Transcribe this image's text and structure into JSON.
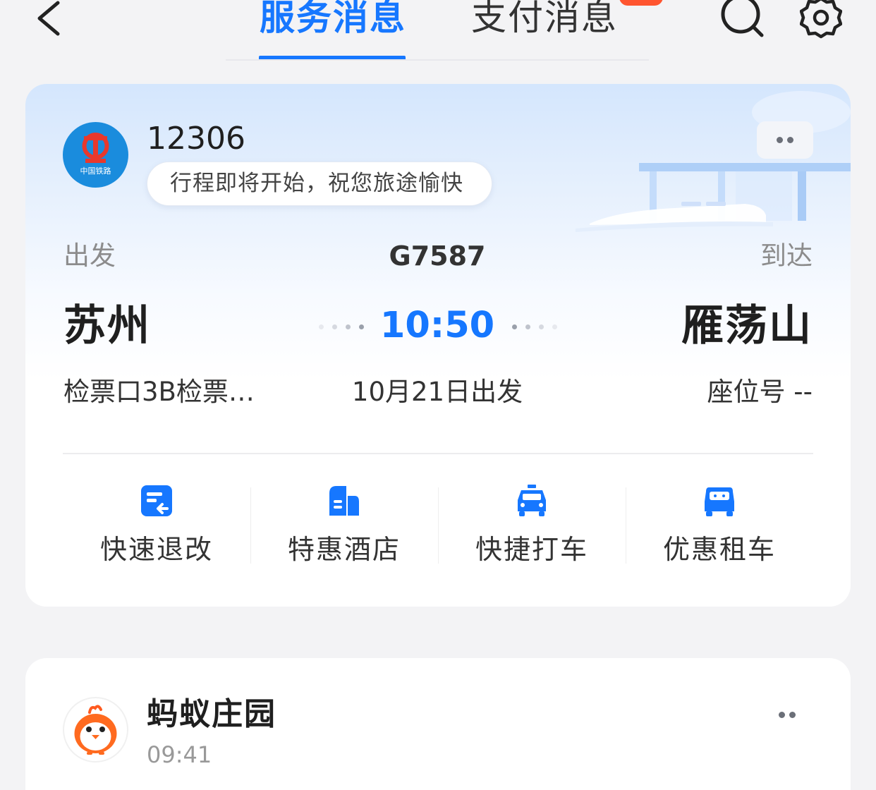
{
  "header": {
    "tabs": [
      {
        "label": "服务消息",
        "active": true
      },
      {
        "label": "支付消息",
        "active": false
      }
    ],
    "icons": [
      "back-icon",
      "search-icon",
      "settings-icon"
    ],
    "accent_color": "#1677ff"
  },
  "trip_card": {
    "sender": "12306",
    "logo_caption": "中国铁路",
    "notice": "行程即将开始，祝您旅途愉快",
    "depart_label": "出发",
    "arrive_label": "到达",
    "train_no": "G7587",
    "from_city": "苏州",
    "to_city": "雁荡山",
    "dep_time": "10:50",
    "gate": "检票口3B检票…",
    "dep_date": "10月21日出发",
    "seat": "座位号 --",
    "actions": [
      {
        "label": "快速退改",
        "icon": "refund-change-icon"
      },
      {
        "label": "特惠酒店",
        "icon": "hotel-icon"
      },
      {
        "label": "快捷打车",
        "icon": "taxi-icon"
      },
      {
        "label": "优惠租车",
        "icon": "car-rental-icon"
      }
    ]
  },
  "farm_card": {
    "name": "蚂蚁庄园",
    "time": "09:41",
    "logo_icon": "chick-icon"
  }
}
